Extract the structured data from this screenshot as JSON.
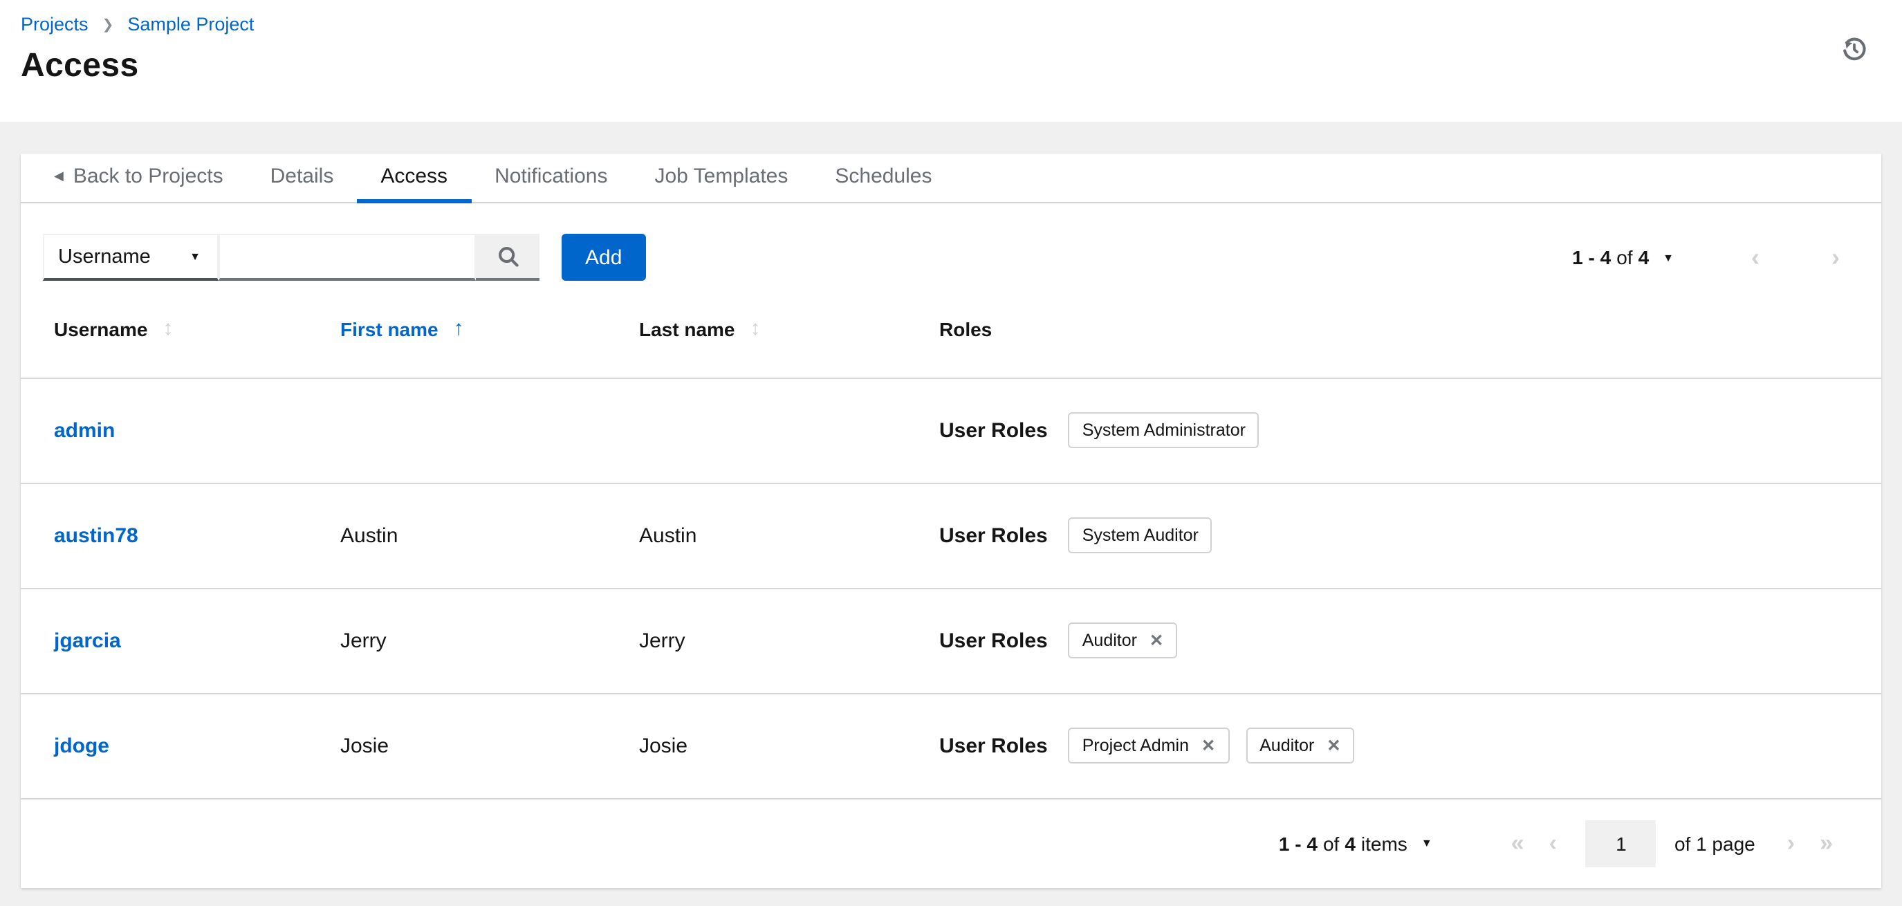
{
  "breadcrumb": {
    "items": [
      {
        "label": "Projects"
      },
      {
        "label": "Sample Project"
      }
    ]
  },
  "page": {
    "title": "Access"
  },
  "icons": {
    "breadcrumb_separator": "❯",
    "back_caret": "◀",
    "dropdown_caret": "▼",
    "sort_inactive": "↕",
    "sort_ascending": "↑",
    "chip_remove": "✕",
    "nav_prev": "‹",
    "nav_next": "›",
    "nav_first": "«",
    "nav_last": "»"
  },
  "tabs": [
    {
      "label": "Back to Projects",
      "type": "back",
      "active": false
    },
    {
      "label": "Details",
      "active": false
    },
    {
      "label": "Access",
      "active": true
    },
    {
      "label": "Notifications",
      "active": false
    },
    {
      "label": "Job Templates",
      "active": false
    },
    {
      "label": "Schedules",
      "active": false
    }
  ],
  "toolbar": {
    "filter_key": "Username",
    "search_value": "",
    "add_label": "Add",
    "pagination": {
      "range": "1 - 4",
      "of_word": "of",
      "total": "4"
    }
  },
  "table": {
    "headers": [
      {
        "label": "Username",
        "sortable": true,
        "sorted": null
      },
      {
        "label": "First name",
        "sortable": true,
        "sorted": "ascending"
      },
      {
        "label": "Last name",
        "sortable": true,
        "sorted": null
      },
      {
        "label": "Roles",
        "sortable": false,
        "sorted": null
      }
    ],
    "rows": [
      {
        "username": "admin",
        "first_name": "",
        "last_name": "",
        "roles_label": "User Roles",
        "chips": [
          {
            "label": "System Administrator",
            "removable": false
          }
        ]
      },
      {
        "username": "austin78",
        "first_name": "Austin",
        "last_name": "Austin",
        "roles_label": "User Roles",
        "chips": [
          {
            "label": "System Auditor",
            "removable": false
          }
        ]
      },
      {
        "username": "jgarcia",
        "first_name": "Jerry",
        "last_name": "Jerry",
        "roles_label": "User Roles",
        "chips": [
          {
            "label": "Auditor",
            "removable": true
          }
        ]
      },
      {
        "username": "jdoge",
        "first_name": "Josie",
        "last_name": "Josie",
        "roles_label": "User Roles",
        "chips": [
          {
            "label": "Project Admin",
            "removable": true
          },
          {
            "label": "Auditor",
            "removable": true
          }
        ]
      }
    ]
  },
  "footer_pagination": {
    "range": "1 - 4",
    "of_word": "of",
    "total": "4",
    "items_word": "items",
    "current_page": "1",
    "page_label": "of 1 page"
  },
  "colors": {
    "accent_blue": "#0066cc",
    "text": "#151515",
    "muted_text": "#6a6e73",
    "border": "#d2d2d2",
    "page_background": "#f0f0f0"
  }
}
